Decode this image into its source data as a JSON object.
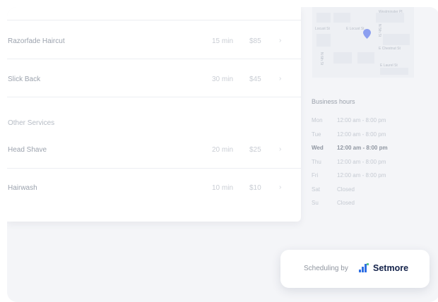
{
  "services": [
    {
      "name": "Razorfade Haircut",
      "duration": "15 min",
      "price": "$85",
      "chevron": "›"
    },
    {
      "name": "Slick Back",
      "duration": "30 min",
      "price": "$45",
      "chevron": "›"
    }
  ],
  "other_section": {
    "title": "Other Services",
    "services": [
      {
        "name": "Head Shave",
        "duration": "20 min",
        "price": "$25",
        "chevron": "›"
      },
      {
        "name": "Hairwash",
        "duration": "10 min",
        "price": "$10",
        "chevron": "›"
      }
    ]
  },
  "map": {
    "streets": [
      "Westminster Pl",
      "Locust St",
      "E Locust St",
      "N 5th St",
      "E Chestnut St",
      "N 6th St",
      "E Laurel St"
    ],
    "pin_color": "#8c9ff0"
  },
  "business_hours": {
    "title": "Business hours",
    "days": [
      {
        "day": "Mon",
        "hours": "12:00 am - 8:00 pm",
        "current": false
      },
      {
        "day": "Tue",
        "hours": "12:00 am - 8:00 pm",
        "current": false
      },
      {
        "day": "Wed",
        "hours": "12:00 am - 8:00 pm",
        "current": true
      },
      {
        "day": "Thu",
        "hours": "12:00 am - 8:00 pm",
        "current": false
      },
      {
        "day": "Fri",
        "hours": "12:00 am - 8:00 pm",
        "current": false
      },
      {
        "day": "Sat",
        "hours": "Closed",
        "current": false
      },
      {
        "day": "Su",
        "hours": "Closed",
        "current": false
      }
    ]
  },
  "badge": {
    "prefix": "Scheduling by",
    "brand": "Setmore",
    "icon": "setmore-logo-icon",
    "brand_color": "#13224a",
    "icon_color": "#2f6fe4"
  }
}
